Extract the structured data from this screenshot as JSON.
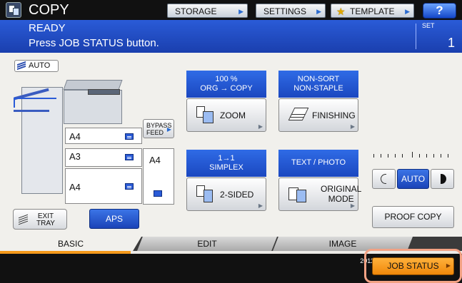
{
  "header": {
    "app_title": "COPY",
    "app_icon": "copy-icon",
    "buttons": {
      "storage": "STORAGE",
      "settings": "SETTINGS",
      "template": "TEMPLATE",
      "help": "?"
    }
  },
  "status": {
    "line1": "READY",
    "line2": "Press JOB STATUS button.",
    "set_label": "SET",
    "set_count": "1"
  },
  "paper": {
    "auto_badge": "AUTO",
    "trays": [
      {
        "size": "A4"
      },
      {
        "size": "A3"
      },
      {
        "size": "A4"
      }
    ],
    "bypass_label": "BYPASS FEED",
    "bypass_size": "A4",
    "exit_tray_label": "EXIT TRAY",
    "aps_label": "APS"
  },
  "functions": {
    "zoom": {
      "header_line1": "100 %",
      "header_line2": "ORG  →  COPY",
      "label": "ZOOM"
    },
    "finishing": {
      "header_line1": "NON-SORT",
      "header_line2": "NON-STAPLE",
      "label": "FINISHING"
    },
    "duplex": {
      "header_line1": "1→1",
      "header_line2": "SIMPLEX",
      "label": "2-SIDED"
    },
    "original_mode": {
      "header": "TEXT / PHOTO",
      "label_line1": "ORIGINAL",
      "label_line2": "MODE"
    }
  },
  "density": {
    "auto_label": "AUTO"
  },
  "proof_copy_label": "PROOF COPY",
  "tabs": [
    "BASIC",
    "EDIT",
    "IMAGE"
  ],
  "footer": {
    "date": "2011/11/",
    "time": "17:",
    "job_status_label": "JOB STATUS"
  },
  "colors": {
    "accent_blue": "#1f4fc8",
    "job_status_orange": "#f59a1c",
    "highlight_ring": "#f3a284"
  }
}
